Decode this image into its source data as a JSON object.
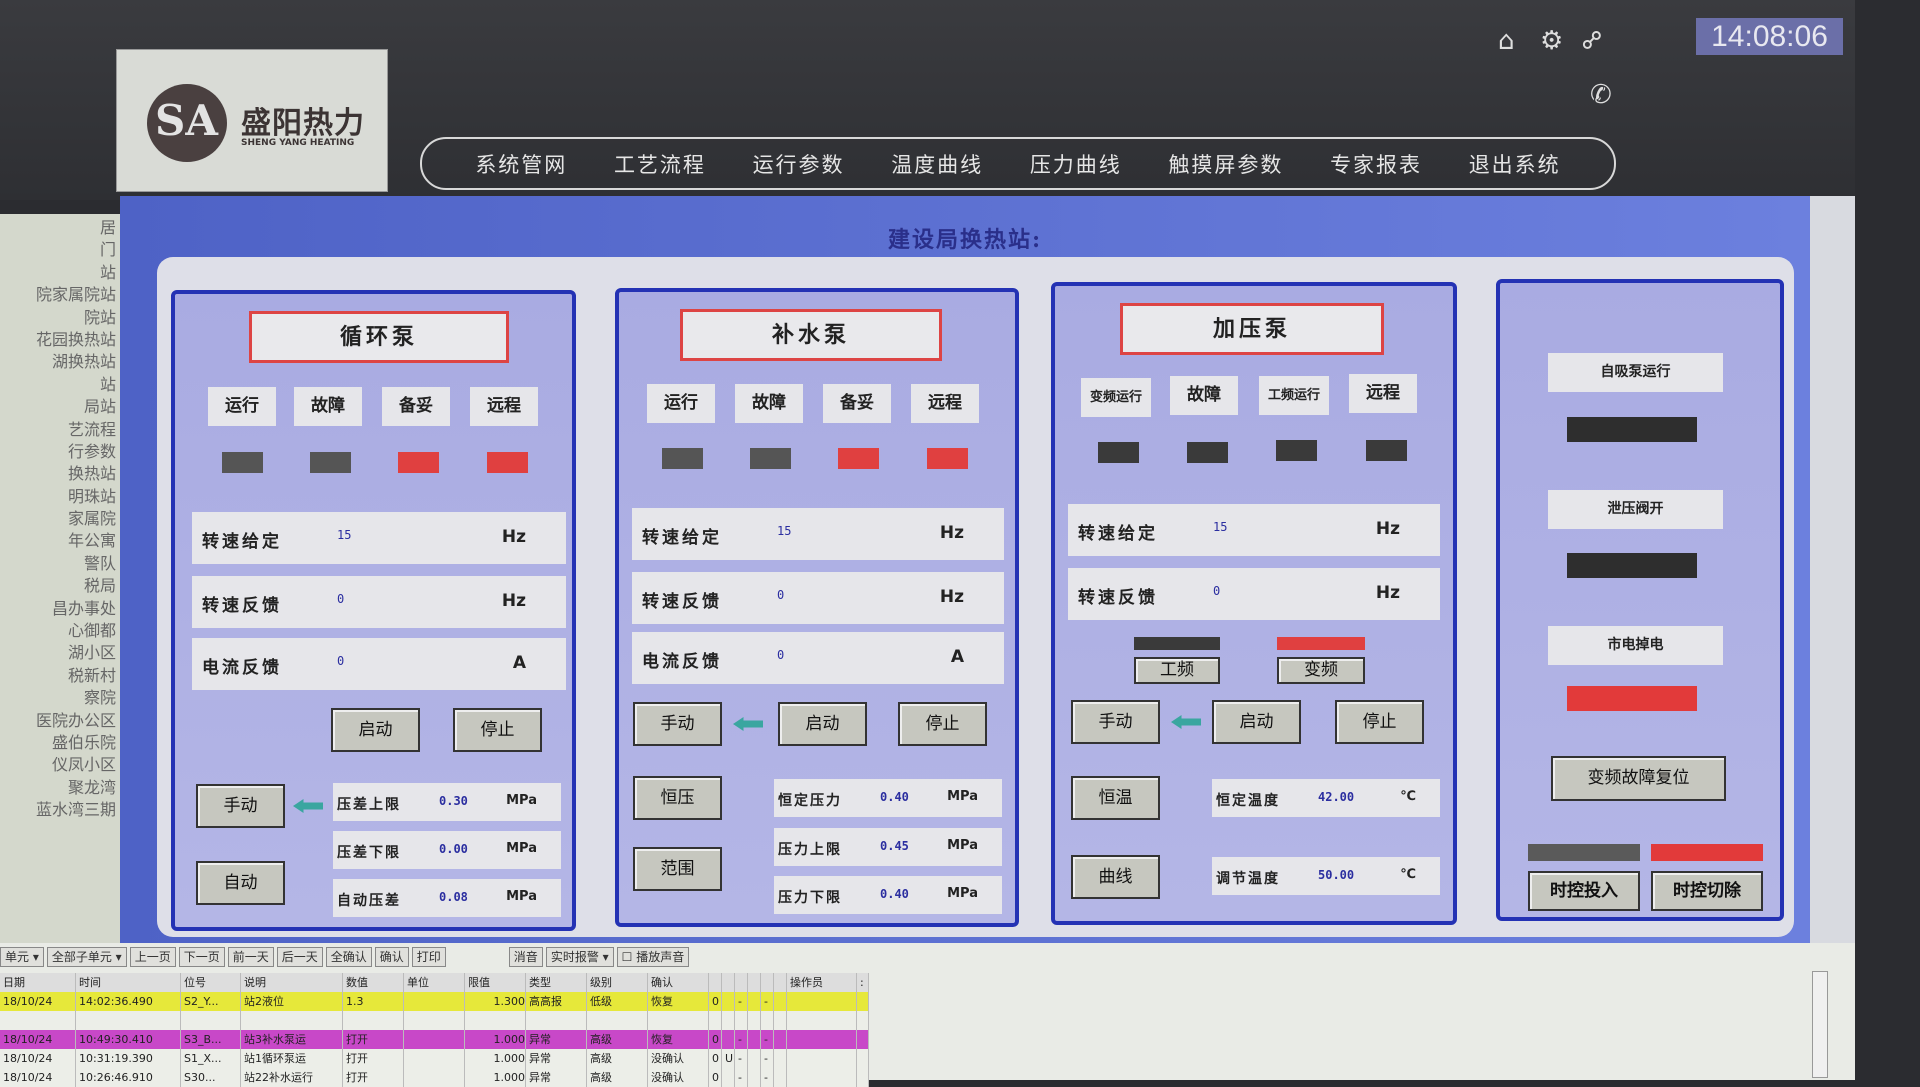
{
  "header": {
    "logo_cn": "盛阳热力",
    "logo_en": "SHENG YANG HEATING",
    "logo_mark": "SA",
    "clock": "14:08:06",
    "nav": [
      "系统管网",
      "工艺流程",
      "运行参数",
      "温度曲线",
      "压力曲线",
      "触摸屏参数",
      "专家报表",
      "退出系统"
    ],
    "icons": [
      "home-icon",
      "gear-icon",
      "link-icon",
      "phone-icon"
    ]
  },
  "sidebar": {
    "items": [
      "居",
      "门",
      "站",
      "院家属院站",
      "院站",
      "花园换热站",
      "湖换热站",
      "站",
      "局站",
      "艺流程",
      "行参数",
      "换热站",
      "明珠站",
      "家属院",
      "年公寓",
      "警队",
      "税局",
      "昌办事处",
      "心御都",
      "湖小区",
      "税新村",
      "察院",
      "医院办公区",
      "盛伯乐院",
      "仪凤小区",
      "聚龙湾",
      "蓝水湾三期"
    ]
  },
  "station_title": "建设局换热站:",
  "circ_pump": {
    "title": "循环泵",
    "status": [
      "运行",
      "故障",
      "备妥",
      "远程"
    ],
    "status_on": [
      false,
      false,
      true,
      true
    ],
    "rows": [
      {
        "k": "转速给定",
        "v": "15",
        "u": "Hz"
      },
      {
        "k": "转速反馈",
        "v": "0",
        "u": "Hz"
      },
      {
        "k": "电流反馈",
        "v": "0",
        "u": "A"
      }
    ],
    "start": "启动",
    "stop": "停止",
    "manual": "手动",
    "auto": "自动",
    "params": [
      {
        "k": "压差上限",
        "v": "0.30",
        "u": "MPa"
      },
      {
        "k": "压差下限",
        "v": "0.00",
        "u": "MPa"
      },
      {
        "k": "自动压差",
        "v": "0.08",
        "u": "MPa"
      }
    ]
  },
  "makeup_pump": {
    "title": "补水泵",
    "status": [
      "运行",
      "故障",
      "备妥",
      "远程"
    ],
    "status_on": [
      false,
      false,
      true,
      true
    ],
    "rows": [
      {
        "k": "转速给定",
        "v": "15",
        "u": "Hz"
      },
      {
        "k": "转速反馈",
        "v": "0",
        "u": "Hz"
      },
      {
        "k": "电流反馈",
        "v": "0",
        "u": "A"
      }
    ],
    "manual": "手动",
    "start": "启动",
    "stop": "停止",
    "const_pressure": "恒压",
    "range": "范围",
    "params": [
      {
        "k": "恒定压力",
        "v": "0.40",
        "u": "MPa"
      },
      {
        "k": "压力上限",
        "v": "0.45",
        "u": "MPa"
      },
      {
        "k": "压力下限",
        "v": "0.40",
        "u": "MPa"
      }
    ]
  },
  "boost_pump": {
    "title": "加压泵",
    "status": [
      "变频运行",
      "故障",
      "工频运行",
      "远程"
    ],
    "status_on": [
      false,
      false,
      false,
      false
    ],
    "rows": [
      {
        "k": "转速给定",
        "v": "15",
        "u": "Hz"
      },
      {
        "k": "转速反馈",
        "v": "0",
        "u": "Hz"
      }
    ],
    "power_freq": "工频",
    "var_freq": "变频",
    "power_freq_on": false,
    "var_freq_on": true,
    "manual": "手动",
    "start": "启动",
    "stop": "停止",
    "const_temp": "恒温",
    "curve": "曲线",
    "params": [
      {
        "k": "恒定温度",
        "v": "42.00",
        "u": "℃"
      },
      {
        "k": "调节温度",
        "v": "50.00",
        "u": "℃"
      }
    ]
  },
  "misc": {
    "items": [
      {
        "label": "自吸泵运行",
        "on": false
      },
      {
        "label": "泄压阀开",
        "on": false
      },
      {
        "label": "市电掉电",
        "on": true
      }
    ],
    "reset": "变频故障复位",
    "timer_on": "时控投入",
    "timer_off": "时控切除",
    "timer_on_state": false,
    "timer_off_state": true
  },
  "alarm": {
    "toolbar": [
      "单元 ▾",
      "全部子单元 ▾",
      "上一页",
      "下一页",
      "前一天",
      "后一天",
      "全确认",
      "确认",
      "打印",
      "消音",
      "实时报警 ▾",
      "☐ 播放声音"
    ],
    "columns": [
      "日期",
      "时间",
      "位号",
      "说明",
      "数值",
      "单位",
      "限值",
      "类型",
      "级别",
      "确认",
      "",
      "",
      "",
      "",
      "",
      "",
      "操作员",
      ":"
    ],
    "rows": [
      {
        "color": "#e6e83a",
        "cells": [
          "18/10/24",
          "14:02:36.490",
          "S2_Y...",
          "站2液位",
          "1.3",
          "",
          "1.300",
          "高高报",
          "低级",
          "恢复",
          "0",
          "",
          "-",
          "",
          "-",
          "",
          "",
          ""
        ]
      },
      {
        "color": "#eceee8",
        "cells": [
          "",
          "",
          "",
          "",
          "",
          "",
          "",
          "",
          "",
          "",
          "",
          "",
          "",
          "",
          "",
          "",
          "",
          ""
        ]
      },
      {
        "color": "#c848c8",
        "cells": [
          "18/10/24",
          "10:49:30.410",
          "S3_B...",
          "站3补水泵运",
          "打开",
          "",
          "1.000",
          "异常",
          "高级",
          "恢复",
          "0",
          "",
          "-",
          "",
          "-",
          "",
          "",
          ""
        ]
      },
      {
        "color": "#eceee8",
        "cells": [
          "18/10/24",
          "10:31:19.390",
          "S1_X...",
          "站1循环泵运",
          "打开",
          "",
          "1.000",
          "异常",
          "高级",
          "没确认",
          "0",
          "U",
          "-",
          "",
          "-",
          "",
          "",
          ""
        ]
      },
      {
        "color": "#eceee8",
        "cells": [
          "18/10/24",
          "10:26:46.910",
          "S30...",
          "站22补水运行",
          "打开",
          "",
          "1.000",
          "异常",
          "高级",
          "没确认",
          "0",
          "",
          "-",
          "",
          "-",
          "",
          "",
          ""
        ]
      }
    ]
  }
}
